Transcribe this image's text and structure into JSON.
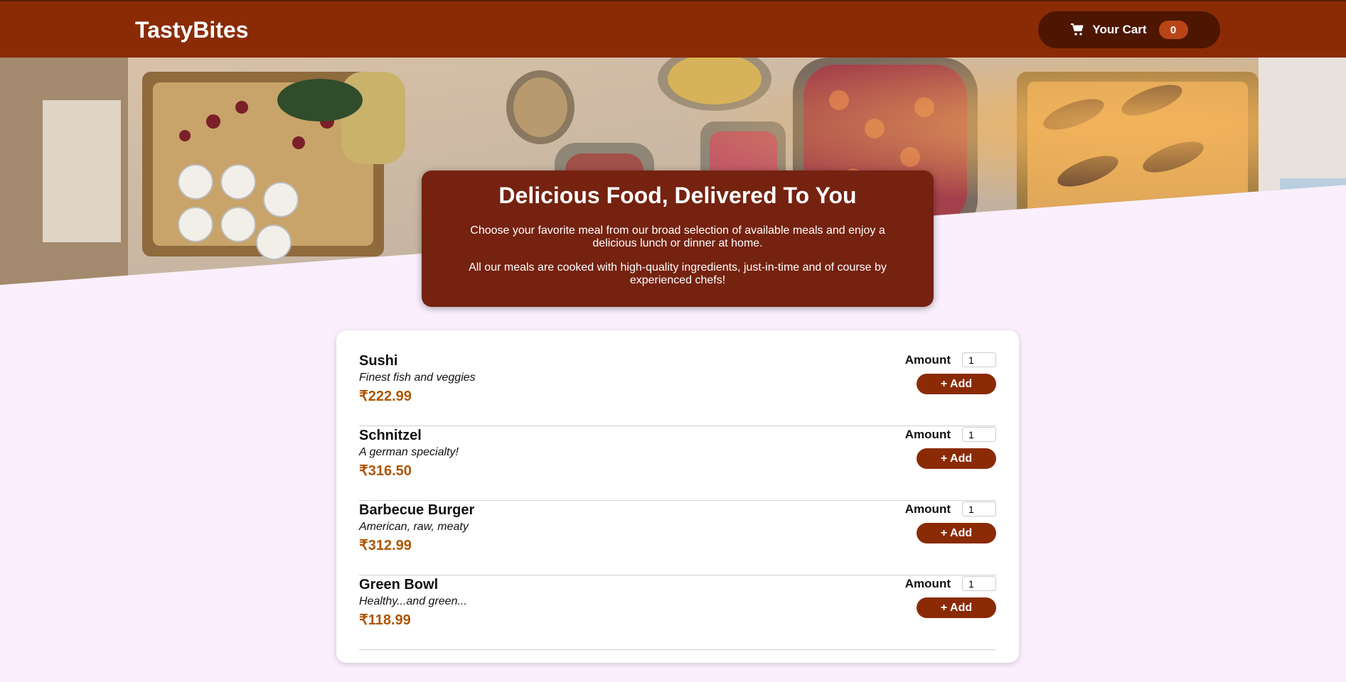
{
  "header": {
    "logo": "TastyBites",
    "cart_label": "Your Cart",
    "cart_count": "0"
  },
  "hero": {
    "image_icon": "buffet-food-photo"
  },
  "summary": {
    "title": "Delicious Food, Delivered To You",
    "para1": "Choose your favorite meal from our broad selection of available meals and enjoy a delicious lunch or dinner at home.",
    "para2": "All our meals are cooked with high-quality ingredients, just-in-time and of course by experienced chefs!"
  },
  "meals": [
    {
      "name": "Sushi",
      "description": "Finest fish and veggies",
      "price": "₹222.99",
      "amount_label": "Amount",
      "amount": "1",
      "add_label": "+ Add"
    },
    {
      "name": "Schnitzel",
      "description": "A german specialty!",
      "price": "₹316.50",
      "amount_label": "Amount",
      "amount": "1",
      "add_label": "+ Add"
    },
    {
      "name": "Barbecue Burger",
      "description": "American, raw, meaty",
      "price": "₹312.99",
      "amount_label": "Amount",
      "amount": "1",
      "add_label": "+ Add"
    },
    {
      "name": "Green Bowl",
      "description": "Healthy...and green...",
      "price": "₹118.99",
      "amount_label": "Amount",
      "amount": "1",
      "add_label": "+ Add"
    }
  ],
  "colors": {
    "header_bg": "#8a2b06",
    "cart_bg": "#4d1601",
    "badge_bg": "#b94517",
    "summary_bg": "#752210",
    "price": "#ad5502",
    "page_bg": "#fbeffd"
  }
}
